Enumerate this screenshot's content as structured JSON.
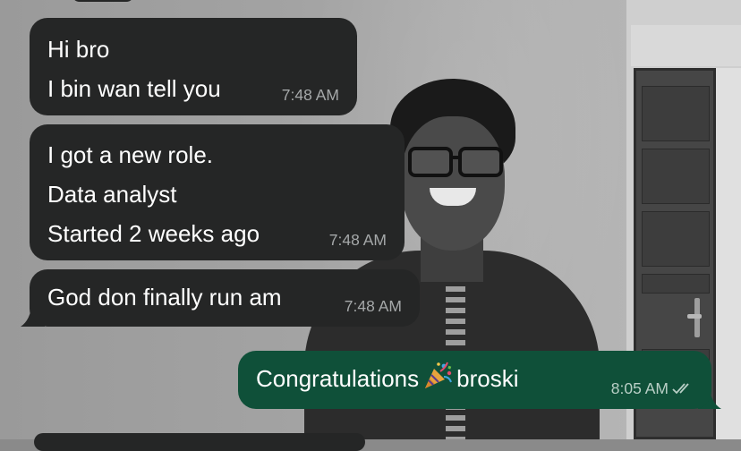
{
  "conversation": {
    "messages": [
      {
        "direction": "incoming",
        "lines": [
          "Hi bro",
          "I bin wan tell you"
        ],
        "time": "7:48 AM"
      },
      {
        "direction": "incoming",
        "lines": [
          "I got a new role.",
          "Data analyst",
          "Started 2 weeks ago"
        ],
        "time": "7:48 AM"
      },
      {
        "direction": "incoming",
        "lines": [
          "God don finally run am"
        ],
        "time": "7:48 AM"
      },
      {
        "direction": "outgoing",
        "text_before": "Congratulations",
        "emoji": "party-popper-icon",
        "text_after": "broski",
        "time": "8:05 AM",
        "status": "read-double-check-icon"
      }
    ]
  },
  "colors": {
    "incoming_bubble": "#252626",
    "outgoing_bubble": "#0f5039",
    "message_text": "#ffffff",
    "incoming_time": "#a5a8a9",
    "outgoing_time": "#b9cfc6"
  }
}
